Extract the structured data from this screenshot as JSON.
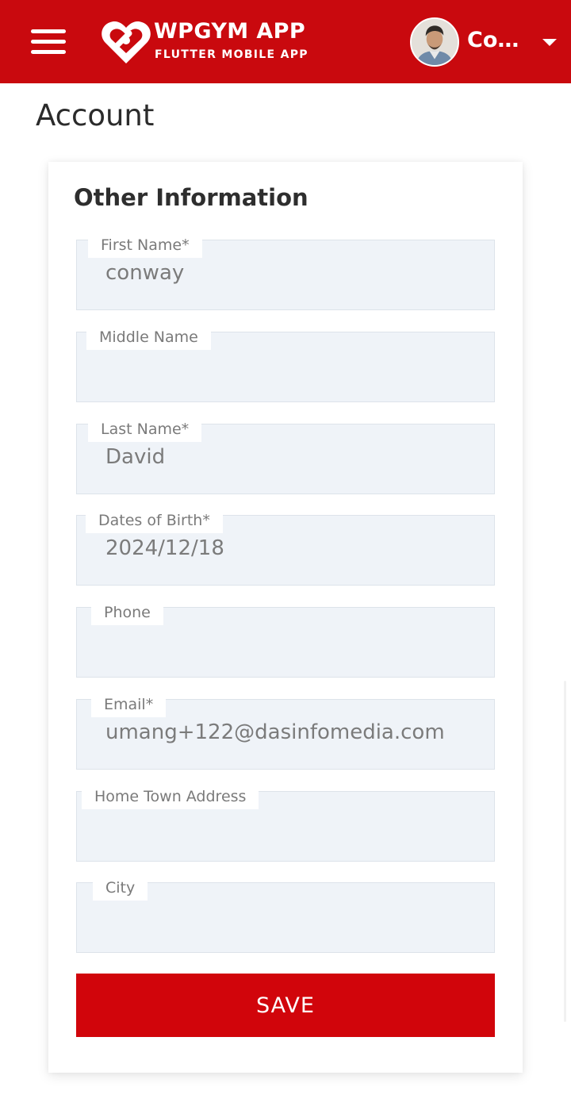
{
  "header": {
    "brand_title": "WPGYM APP",
    "brand_subtitle": "FLUTTER MOBILE APP",
    "user_name": "Con...",
    "menu_icon": "hamburger-icon",
    "logo_icon": "heart-logo-icon",
    "caret_icon": "caret-down-icon",
    "bar_color": "#c9090e"
  },
  "page": {
    "title": "Account"
  },
  "form": {
    "section_title": "Other Information",
    "fields": [
      {
        "label": "First Name*",
        "value": "conway"
      },
      {
        "label": "Middle Name",
        "value": ""
      },
      {
        "label": "Last Name*",
        "value": "David"
      },
      {
        "label": "Dates of Birth*",
        "value": "2024/12/18"
      },
      {
        "label": "Phone",
        "value": ""
      },
      {
        "label": "Email*",
        "value": "umang+122@dasinfomedia.com"
      },
      {
        "label": "Home Town Address",
        "value": ""
      },
      {
        "label": "City",
        "value": ""
      }
    ],
    "save_label": "SAVE",
    "save_color": "#d1050b"
  }
}
